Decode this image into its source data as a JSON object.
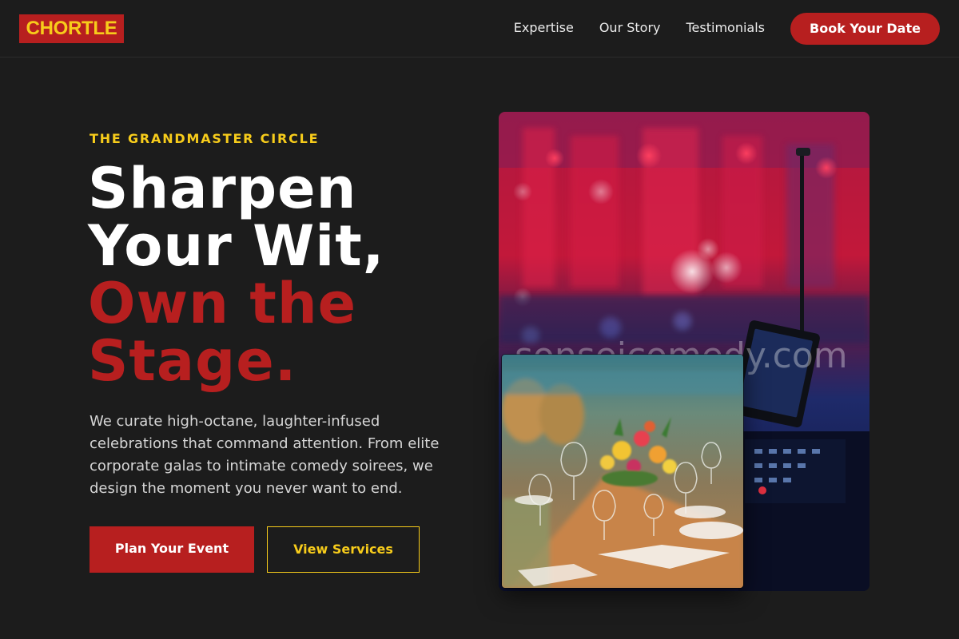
{
  "brand": {
    "logo": "CHORTLE"
  },
  "nav": {
    "links": [
      "Expertise",
      "Our Story",
      "Testimonials"
    ],
    "cta": "Book Your Date"
  },
  "hero": {
    "eyebrow": "THE GRANDMASTER CIRCLE",
    "headline_white": [
      "Sharpen",
      "Your Wit,"
    ],
    "headline_red": [
      "Own the",
      "Stage."
    ],
    "description": "We curate high-octane, laughter-infused celebrations that command attention. From elite corporate galas to intimate comedy soirees, we design the moment you never want to end.",
    "primary_button": "Plan Your Event",
    "secondary_button": "View Services"
  },
  "media": {
    "watermark": "sonseicomedy.com"
  },
  "colors": {
    "background": "#1c1c1c",
    "accent_red": "#b71f1f",
    "accent_yellow": "#f7cc1b"
  }
}
